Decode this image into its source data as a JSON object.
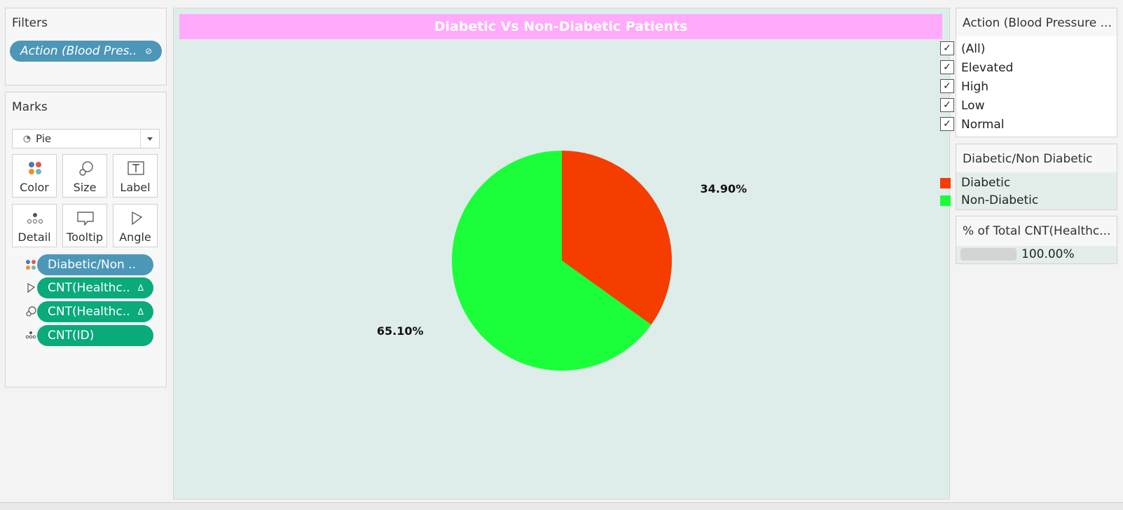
{
  "filters": {
    "title": "Filters",
    "pill_label": "Action (Blood Pres.."
  },
  "marks": {
    "title": "Marks",
    "mark_type": "Pie",
    "buttons": {
      "color": "Color",
      "size": "Size",
      "label": "Label",
      "detail": "Detail",
      "tooltip": "Tooltip",
      "angle": "Angle"
    },
    "fields": [
      {
        "label": "Diabetic/Non ..",
        "kind": "color",
        "suffix": ""
      },
      {
        "label": "CNT(Healthc..",
        "kind": "angle",
        "suffix": "Δ"
      },
      {
        "label": "CNT(Healthc..",
        "kind": "size",
        "suffix": "Δ"
      },
      {
        "label": "CNT(ID)",
        "kind": "detail",
        "suffix": ""
      }
    ]
  },
  "viz": {
    "title": "Diabetic Vs Non-Diabetic Patients"
  },
  "chart_data": {
    "type": "pie",
    "title": "Diabetic Vs Non-Diabetic Patients",
    "categories": [
      "Diabetic",
      "Non-Diabetic"
    ],
    "values": [
      34.9,
      65.1
    ],
    "labels": [
      "34.90%",
      "65.10%"
    ],
    "colors": [
      "#f53d00",
      "#1aff3a"
    ]
  },
  "bp_filter": {
    "title": "Action (Blood Pressure ...",
    "options": [
      {
        "label": "(All)",
        "checked": true
      },
      {
        "label": "Elevated",
        "checked": true
      },
      {
        "label": "High",
        "checked": true
      },
      {
        "label": "Low",
        "checked": true
      },
      {
        "label": "Normal",
        "checked": true
      }
    ],
    "check_glyph": "✓"
  },
  "legend": {
    "title": "Diabetic/Non Diabetic",
    "items": [
      {
        "label": "Diabetic",
        "color": "#f53d00"
      },
      {
        "label": "Non-Diabetic",
        "color": "#1aff3a"
      }
    ]
  },
  "size_legend": {
    "title": "% of Total CNT(Healthc...",
    "value": "100.00%"
  }
}
